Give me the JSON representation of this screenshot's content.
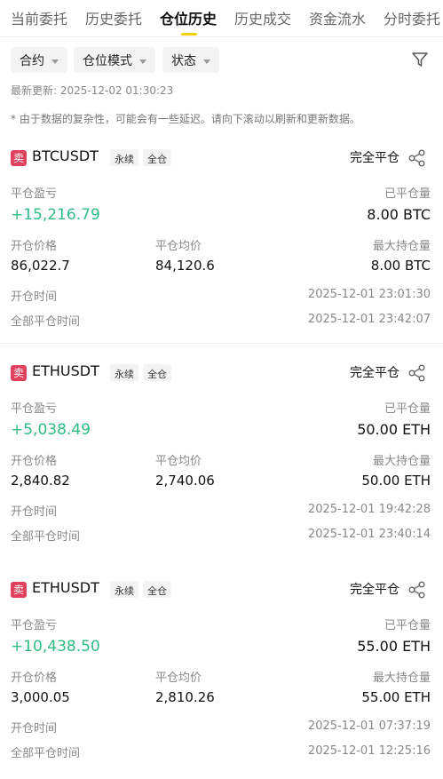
{
  "tabs": [
    "当前委托",
    "历史委托",
    "仓位历史",
    "历史成交",
    "资金流水",
    "分时委托"
  ],
  "active_tab": "仓位历史",
  "filters": {
    "contract": "合约",
    "position_mode": "仓位模式",
    "status": "状态"
  },
  "last_updated": "最新更新: 2025-12-02 01:30:23",
  "note": "* 由于数据的复杂性，可能会有一些延迟。请向下滚动以刷新和更新数据。",
  "labels": {
    "pnl": "平仓盈亏",
    "closed_qty": "已平仓量",
    "entry_price": "开仓价格",
    "avg_close_price": "平仓均价",
    "max_position": "最大持仓量",
    "open_time": "开仓时间",
    "full_close_time": "全部平仓时间"
  },
  "colors": {
    "profit": "#2ebd85",
    "sell": "#e0415c",
    "tab_indicator": "#f0d000"
  },
  "positions": [
    {
      "side": "卖",
      "symbol": "BTCUSDT",
      "tag1": "永续",
      "tag2": "全仓",
      "status": "完全平仓",
      "pnl": "+15,216.79",
      "closed_qty": "8.00 BTC",
      "entry_price": "86,022.7",
      "avg_close_price": "84,120.6",
      "max_position": "8.00 BTC",
      "open_time": "2025-12-01 23:01:30",
      "full_close_time": "2025-12-01 23:42:07"
    },
    {
      "side": "卖",
      "symbol": "ETHUSDT",
      "tag1": "永续",
      "tag2": "全仓",
      "status": "完全平仓",
      "pnl": "+5,038.49",
      "closed_qty": "50.00 ETH",
      "entry_price": "2,840.82",
      "avg_close_price": "2,740.06",
      "max_position": "50.00 ETH",
      "open_time": "2025-12-01 19:42:28",
      "full_close_time": "2025-12-01 23:40:14"
    },
    {
      "side": "卖",
      "symbol": "ETHUSDT",
      "tag1": "永续",
      "tag2": "全仓",
      "status": "完全平仓",
      "pnl": "+10,438.50",
      "closed_qty": "55.00 ETH",
      "entry_price": "3,000.05",
      "avg_close_price": "2,810.26",
      "max_position": "55.00 ETH",
      "open_time": "2025-12-01 07:37:19",
      "full_close_time": "2025-12-01 12:25:16"
    }
  ]
}
